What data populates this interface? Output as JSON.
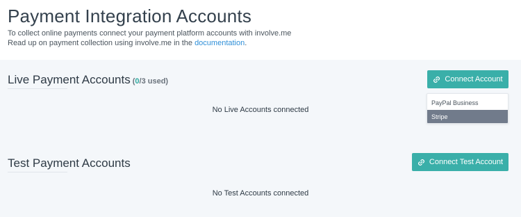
{
  "header": {
    "title": "Payment Integration Accounts",
    "line1": "To collect online payments connect your payment platform accounts with involve.me",
    "line2_prefix": "Read up on payment collection using involve.me in the ",
    "line2_link": "documentation",
    "line2_suffix": "."
  },
  "live": {
    "title": "Live Payment Accounts",
    "usage_open": "(",
    "usage_count": "0",
    "usage_rest": "/3 used)",
    "button_label": "Connect Account",
    "button_icon": "link-icon",
    "empty_message": "No Live Accounts connected",
    "dropdown": {
      "options": [
        "PayPal Business",
        "Stripe"
      ],
      "highlighted": "Stripe"
    }
  },
  "test": {
    "title": "Test Payment Accounts",
    "button_label": "Connect Test Account",
    "button_icon": "link-icon",
    "empty_message": "No Test Accounts connected"
  },
  "colors": {
    "accent": "#3aafa9",
    "link": "#2f8fd8",
    "section_bg": "#f4f7fa",
    "highlight_bg": "#717b8b"
  }
}
